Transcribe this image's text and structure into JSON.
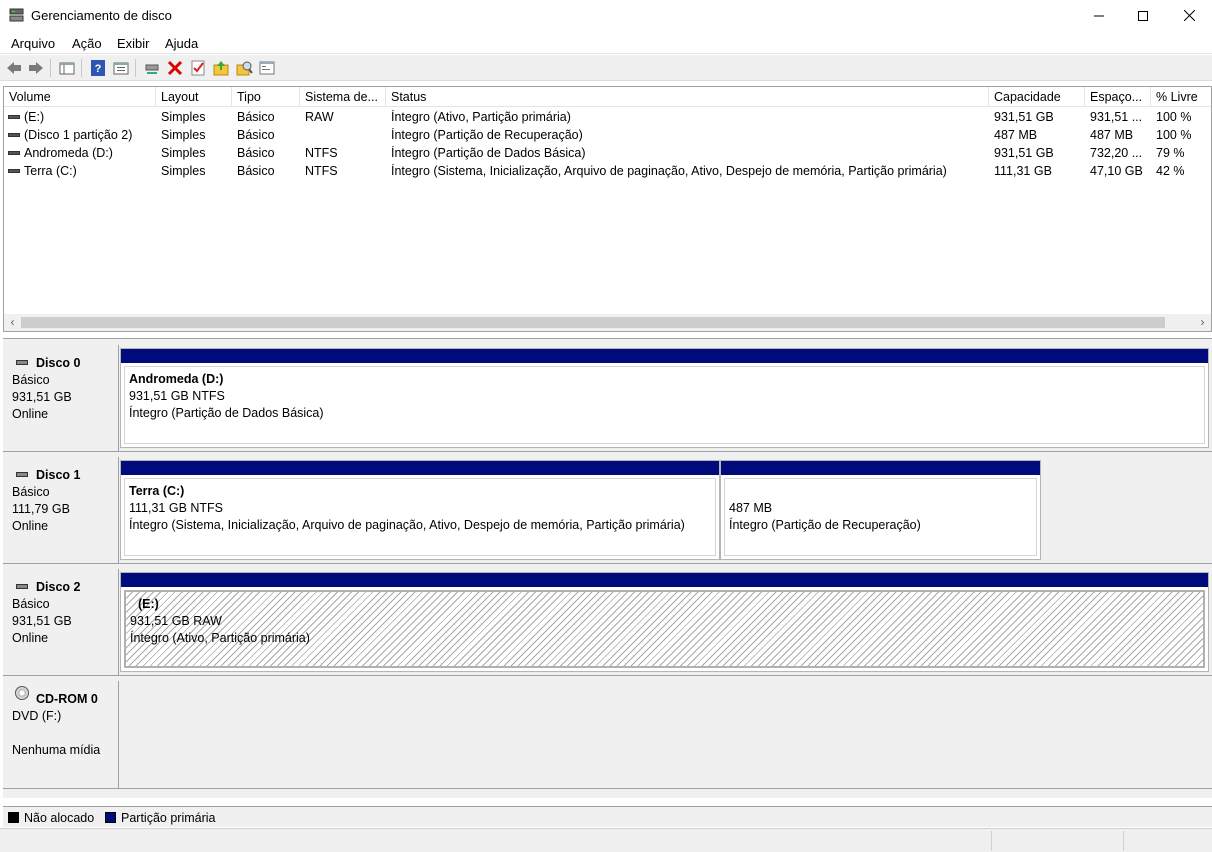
{
  "window": {
    "title": "Gerenciamento de disco",
    "icon": "disk-management-icon"
  },
  "menu": {
    "items": [
      "Arquivo",
      "Ação",
      "Exibir",
      "Ajuda"
    ]
  },
  "toolbar": {
    "buttons": [
      "back-icon",
      "forward-icon",
      "show-hide-tree-icon",
      "help-icon",
      "properties-icon",
      "connect-drive-icon",
      "delete-icon",
      "check-icon",
      "open-folder-up-icon",
      "explore-icon",
      "console-icon"
    ]
  },
  "volume_list": {
    "columns": [
      "Volume",
      "Layout",
      "Tipo",
      "Sistema de...",
      "Status",
      "Capacidade",
      "Espaço...",
      "% Livre"
    ],
    "rows": [
      {
        "volume": "(E:)",
        "layout": "Simples",
        "tipo": "Básico",
        "sistema": "RAW",
        "status": "Íntegro (Ativo, Partição primária)",
        "capacidade": "931,51 GB",
        "espaco": "931,51 ...",
        "livre": "100 %"
      },
      {
        "volume": "(Disco 1 partição 2)",
        "layout": "Simples",
        "tipo": "Básico",
        "sistema": "",
        "status": "Íntegro (Partição de Recuperação)",
        "capacidade": "487 MB",
        "espaco": "487 MB",
        "livre": "100 %"
      },
      {
        "volume": "Andromeda (D:)",
        "layout": "Simples",
        "tipo": "Básico",
        "sistema": "NTFS",
        "status": "Íntegro (Partição de Dados Básica)",
        "capacidade": "931,51 GB",
        "espaco": "732,20 ...",
        "livre": "79 %"
      },
      {
        "volume": "Terra (C:)",
        "layout": "Simples",
        "tipo": "Básico",
        "sistema": "NTFS",
        "status": "Íntegro (Sistema, Inicialização, Arquivo de paginação, Ativo, Despejo de memória, Partição primária)",
        "capacidade": "111,31 GB",
        "espaco": "47,10 GB",
        "livre": "42 %"
      }
    ],
    "scroll_left": "‹",
    "scroll_right": "›"
  },
  "disks": {
    "disk0": {
      "name": "Disco 0",
      "type": "Básico",
      "size": "931,51 GB",
      "state": "Online",
      "partitions": [
        {
          "title": "Andromeda  (D:)",
          "info": "931,51 GB NTFS",
          "status": "Íntegro (Partição de Dados Básica)"
        }
      ]
    },
    "disk1": {
      "name": "Disco 1",
      "type": "Básico",
      "size": "111,79 GB",
      "state": "Online",
      "partitions": [
        {
          "title": "Terra  (C:)",
          "info": "111,31 GB NTFS",
          "status": "Íntegro (Sistema, Inicialização, Arquivo de paginação, Ativo, Despejo de memória, Partição primária)"
        },
        {
          "title": "",
          "info": "487 MB",
          "status": "Íntegro (Partição de Recuperação)"
        }
      ]
    },
    "disk2": {
      "name": "Disco 2",
      "type": "Básico",
      "size": "931,51 GB",
      "state": "Online",
      "partitions": [
        {
          "title": "(E:)",
          "info": "931,51 GB RAW",
          "status": "Íntegro (Ativo, Partição primária)"
        }
      ]
    },
    "cdrom0": {
      "name": "CD-ROM 0",
      "type": "DVD (F:)",
      "state": "Nenhuma mídia"
    }
  },
  "legend": {
    "unallocated": "Não alocado",
    "primary": "Partição primária",
    "unallocated_color": "#000000",
    "primary_color": "#000c7b"
  }
}
